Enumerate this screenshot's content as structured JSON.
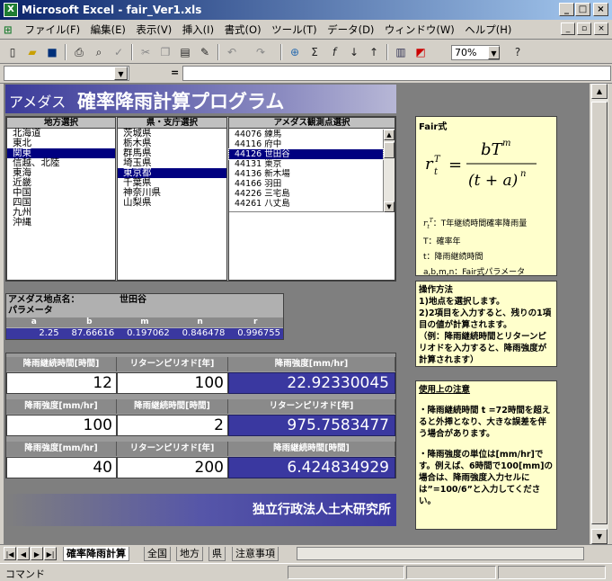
{
  "window": {
    "title": "Microsoft Excel - fair_Ver1.xls"
  },
  "menu": [
    "ファイル(F)",
    "編集(E)",
    "表示(V)",
    "挿入(I)",
    "書式(O)",
    "ツール(T)",
    "データ(D)",
    "ウィンドウ(W)",
    "ヘルプ(H)"
  ],
  "toolbar": {
    "zoom": "70%",
    "formula_eq": "="
  },
  "banner": {
    "prefix": "アメダス",
    "title": "確率降雨計算プログラム"
  },
  "lists": {
    "region": {
      "header": "地方選択",
      "items": [
        "北海道",
        "東北",
        "関東",
        "信越、北陸",
        "東海",
        "近畿",
        "中国",
        "四国",
        "九州",
        "沖縄"
      ],
      "selected": 2
    },
    "pref": {
      "header": "県・支庁選択",
      "items": [
        "茨城県",
        "栃木県",
        "群馬県",
        "埼玉県",
        "東京都",
        "千葉県",
        "神奈川県",
        "山梨県"
      ],
      "selected": 4
    },
    "station": {
      "header": "アメダス観測点選択",
      "items": [
        "44076 練馬",
        "44116 府中",
        "44126 世田谷",
        "44131 東京",
        "44136 新木場",
        "44166 羽田",
        "44226 三宅島",
        "44261 八丈島"
      ],
      "selected": 2
    }
  },
  "params": {
    "label1": "アメダス地点名：",
    "station": "世田谷",
    "label2": "パラメータ",
    "headers": [
      "a",
      "b",
      "m",
      "n",
      "r"
    ],
    "values": [
      "2.25",
      "87.66616",
      "0.197062",
      "0.846478",
      "0.996755"
    ]
  },
  "calc1": {
    "h1": "降雨継続時間[時間]",
    "h2": "リターンピリオド[年]",
    "h3": "降雨強度[mm/hr]",
    "v1": "12",
    "v2": "100",
    "res": "22.92330045"
  },
  "calc2": {
    "h1": "降雨強度[mm/hr]",
    "h2": "降雨継続時間[時間]",
    "h3": "リターンピリオド[年]",
    "v1": "100",
    "v2": "2",
    "res": "975.7583477"
  },
  "calc3": {
    "h1": "降雨強度[mm/hr]",
    "h2": "リターンピリオド[年]",
    "h3": "降雨継続時間[時間]",
    "v1": "40",
    "v2": "200",
    "res": "6.424834929"
  },
  "org": "独立行政法人土木研究所",
  "fair": {
    "title": "Fair式",
    "legend": [
      "：T年継続時間確率降雨量",
      "T：確率年",
      "t：降雨継続時間",
      "a,b,m,n：Fair式パラメータ"
    ]
  },
  "howto": {
    "title": "操作方法",
    "lines": [
      "1)地点を選択します。",
      "2)2項目を入力すると、残りの1項目の値が計算されます。",
      "（例：降雨継続時間とリターンピリオドを入力すると、降雨強度が計算されます）"
    ]
  },
  "caution": {
    "title": "使用上の注意",
    "lines": [
      "・降雨継続時間 t =72時間を超えると外挿となり、大きな誤差を伴う場合があります。",
      "・降雨強度の単位は[mm/hr]です。例えば、6時間で100[mm]の場合は、降雨強度入力セルには”=100/6”と入力してください。"
    ]
  },
  "tabs": [
    "確率降雨計算",
    "全国",
    "地方",
    "県",
    "注意事項"
  ],
  "status": "コマンド"
}
